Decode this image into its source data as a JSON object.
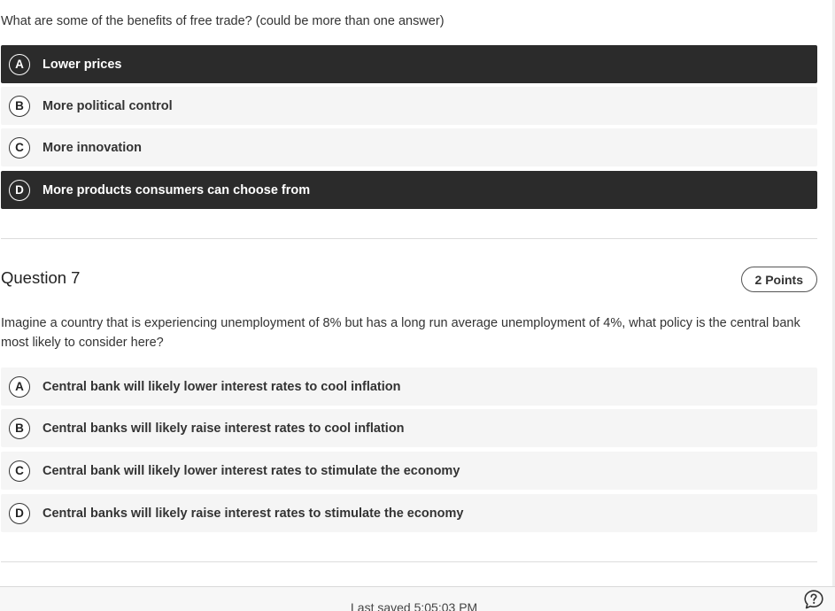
{
  "question6": {
    "prompt": "What are some of the benefits of free trade? (could be more than one answer)",
    "options": [
      {
        "letter": "A",
        "label": "Lower prices",
        "selected": true
      },
      {
        "letter": "B",
        "label": "More political control",
        "selected": false
      },
      {
        "letter": "C",
        "label": "More innovation",
        "selected": false
      },
      {
        "letter": "D",
        "label": "More products consumers can choose from",
        "selected": true
      }
    ]
  },
  "question7": {
    "title": "Question 7",
    "points": "2 Points",
    "prompt": "Imagine a country that is experiencing unemployment of 8% but has a long run average unemployment of 4%, what policy is the central bank most likely to consider here?",
    "options": [
      {
        "letter": "A",
        "label": "Central bank will likely lower interest rates to cool inflation",
        "selected": false
      },
      {
        "letter": "B",
        "label": "Central banks will likely raise interest rates to cool inflation",
        "selected": false
      },
      {
        "letter": "C",
        "label": "Central bank will likely lower interest rates to stimulate the economy",
        "selected": false
      },
      {
        "letter": "D",
        "label": "Central banks will likely raise interest rates to stimulate the economy",
        "selected": false
      }
    ]
  },
  "footer": {
    "saved_text": "Last saved 5:05:03 PM",
    "help_icon": "help-question-icon"
  },
  "colors": {
    "selected_bg": "#2b2b2b",
    "option_bg": "#f5f5f5"
  }
}
